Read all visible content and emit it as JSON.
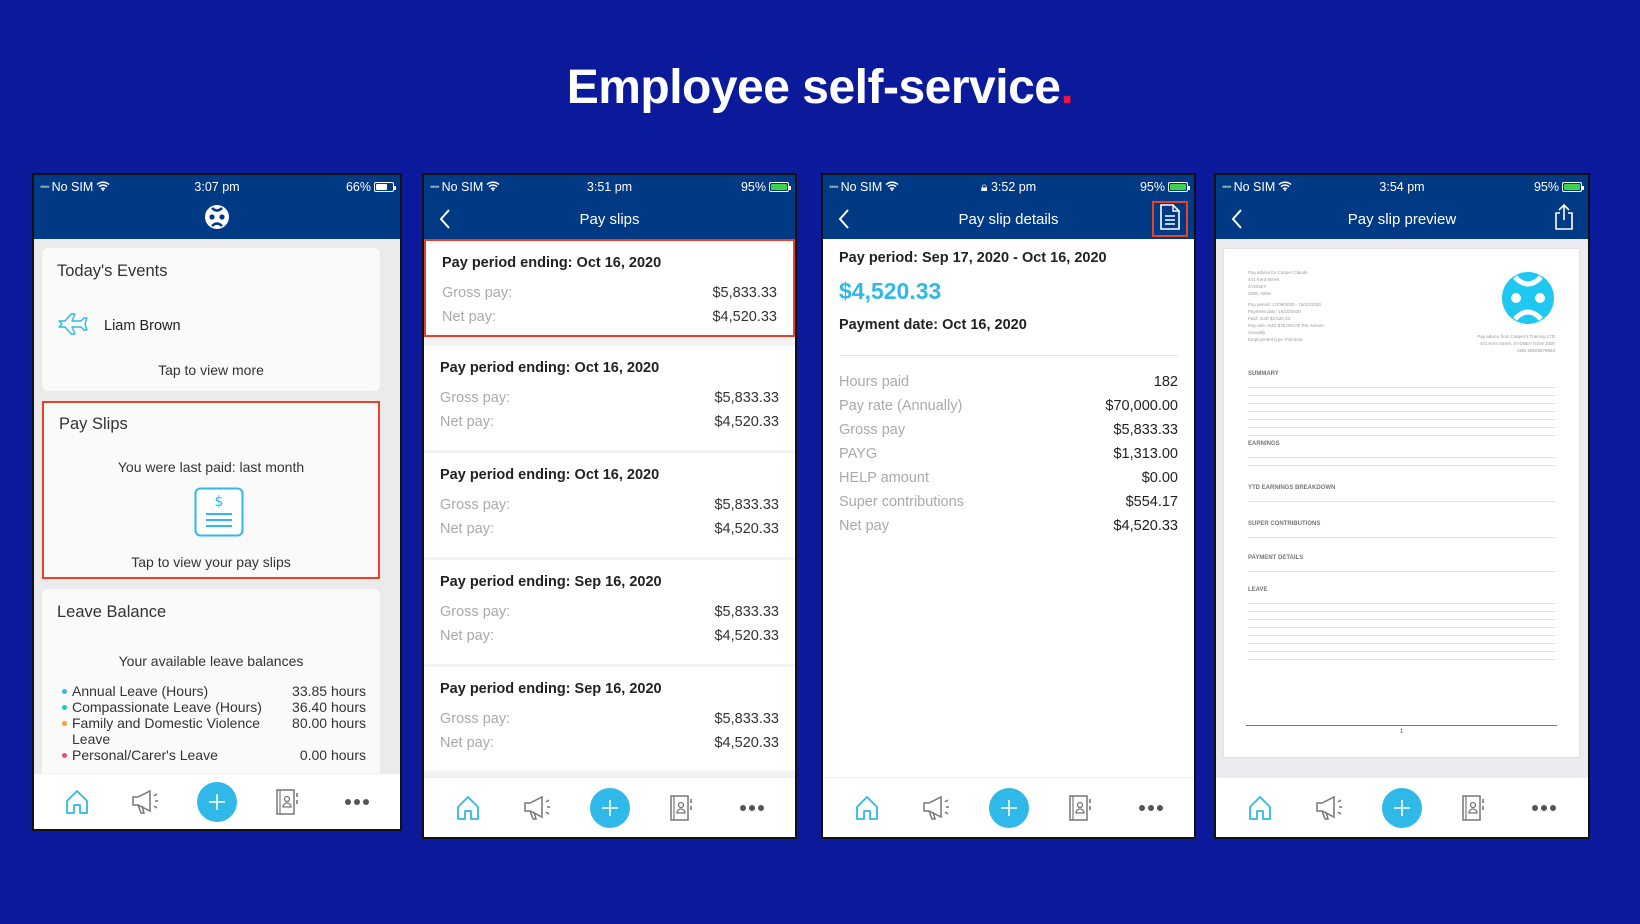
{
  "slide": {
    "title": "Employee self-service",
    "title_dot": ".",
    "accent_dot_color": "#e8173c",
    "background": "#0a1a9a"
  },
  "colors": {
    "nav": "#003984",
    "accent": "#2fb8e8",
    "highlight": "#e8432a"
  },
  "tabbar": [
    {
      "icon": "home-icon",
      "label": "Home"
    },
    {
      "icon": "megaphone-icon",
      "label": "Announcements"
    },
    {
      "icon": "plus-icon",
      "label": "Add"
    },
    {
      "icon": "contacts-book-icon",
      "label": "Directory"
    },
    {
      "icon": "more-icon",
      "label": "More"
    }
  ],
  "screens": {
    "home": {
      "status": {
        "carrier": "No SIM",
        "time": "3:07 pm",
        "battery": "66%",
        "battery_level": 0.66
      },
      "events": {
        "title": "Today's Events",
        "person": "Liam Brown",
        "more": "Tap to view more"
      },
      "payslips": {
        "title": "Pay Slips",
        "last_paid": "You were last paid: last month",
        "cta": "Tap to view your pay slips"
      },
      "leave": {
        "title": "Leave Balance",
        "subtitle": "Your available leave balances",
        "items": [
          {
            "label": "Annual Leave (Hours)",
            "value": "33.85 hours",
            "color": "#2fb8e8"
          },
          {
            "label": "Compassionate Leave (Hours)",
            "value": "36.40 hours",
            "color": "#1fc9b4"
          },
          {
            "label": "Family and Domestic Violence Leave",
            "value": "80.00 hours",
            "color": "#f5a030"
          },
          {
            "label": "Personal/Carer's Leave",
            "value": "0.00 hours",
            "color": "#ef4b7b"
          }
        ]
      }
    },
    "list": {
      "status": {
        "carrier": "No SIM",
        "time": "3:51 pm",
        "battery": "95%",
        "battery_level": 0.95
      },
      "title": "Pay slips",
      "gross_label": "Gross pay:",
      "net_label": "Net pay:",
      "slips": [
        {
          "period": "Pay period ending: Oct 16, 2020",
          "gross": "$5,833.33",
          "net": "$4,520.33"
        },
        {
          "period": "Pay period ending: Oct 16, 2020",
          "gross": "$5,833.33",
          "net": "$4,520.33"
        },
        {
          "period": "Pay period ending: Oct 16, 2020",
          "gross": "$5,833.33",
          "net": "$4,520.33"
        },
        {
          "period": "Pay period ending: Sep 16, 2020",
          "gross": "$5,833.33",
          "net": "$4,520.33"
        },
        {
          "period": "Pay period ending: Sep 16, 2020",
          "gross": "$5,833.33",
          "net": "$4,520.33"
        }
      ]
    },
    "details": {
      "status": {
        "carrier": "No SIM",
        "time": "3:52 pm",
        "battery": "95%",
        "battery_level": 0.95
      },
      "title": "Pay slip details",
      "period": "Pay period: Sep 17, 2020 - Oct 16, 2020",
      "amount": "$4,520.33",
      "payment_date": "Payment date: Oct 16, 2020",
      "rows": [
        {
          "k": "Hours paid",
          "v": "182"
        },
        {
          "k": "Pay rate (Annually)",
          "v": "$70,000.00"
        },
        {
          "k": "Gross pay",
          "v": "$5,833.33"
        },
        {
          "k": "PAYG",
          "v": "$1,313.00"
        },
        {
          "k": "HELP amount",
          "v": "$0.00"
        },
        {
          "k": "Super contributions",
          "v": "$554.17"
        },
        {
          "k": "Net pay",
          "v": "$4,520.33"
        }
      ]
    },
    "preview": {
      "status": {
        "carrier": "No SIM",
        "time": "3:54 pm",
        "battery": "95%",
        "battery_level": 0.95
      },
      "title": "Pay slip preview",
      "doc": {
        "employee_lines": [
          "Pay advice for Casper Claude",
          "441 Kent Street",
          "SYDNEY",
          "2000, NSW"
        ],
        "pay_lines": [
          "Pay period: 17/09/2020 - 16/10/2020",
          "Payment date: 16/10/2020",
          "Paid: AUD $4,520.33",
          "Pay rate: AUD $70,000.00 Per Annum",
          "Annually",
          "Employment type: Full-time"
        ],
        "employer_lines": [
          "Pay advice from Casper's Training LTD",
          "441 Kent Street, SYDNEY NSW 2000",
          "ABN 59606879663"
        ],
        "sections": [
          "SUMMARY",
          "EARNINGS",
          "YTD EARNINGS BREAKDOWN",
          "SUPER CONTRIBUTIONS",
          "PAYMENT DETAILS",
          "LEAVE"
        ],
        "page_number": "1"
      }
    }
  }
}
